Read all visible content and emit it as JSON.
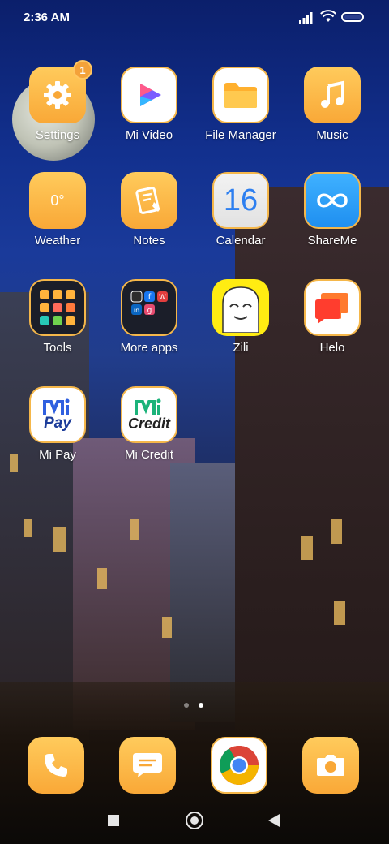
{
  "status_bar": {
    "time": "2:36 AM",
    "icons": [
      "signal-icon",
      "wifi-icon",
      "battery-icon"
    ]
  },
  "apps": [
    {
      "label": "Settings",
      "icon": "gear-icon",
      "badge": "1"
    },
    {
      "label": "Mi Video",
      "icon": "play-icon"
    },
    {
      "label": "File Manager",
      "icon": "folder-icon"
    },
    {
      "label": "Music",
      "icon": "music-note-icon"
    },
    {
      "label": "Weather",
      "icon": "weather-icon",
      "icon_text": "0°"
    },
    {
      "label": "Notes",
      "icon": "note-pencil-icon"
    },
    {
      "label": "Calendar",
      "icon": "calendar-icon",
      "icon_text": "16"
    },
    {
      "label": "ShareMe",
      "icon": "infinity-icon"
    },
    {
      "label": "Tools",
      "icon": "tools-folder-icon"
    },
    {
      "label": "More apps",
      "icon": "apps-folder-icon"
    },
    {
      "label": "Zili",
      "icon": "ghost-face-icon"
    },
    {
      "label": "Helo",
      "icon": "chat-bubbles-icon"
    },
    {
      "label": "Mi Pay",
      "icon": "mi-pay-logo",
      "logo_text": "Pay"
    },
    {
      "label": "Mi Credit",
      "icon": "mi-credit-logo",
      "logo_text": "Credit"
    }
  ],
  "page_indicator": {
    "pages": 2,
    "current": 2
  },
  "dock": [
    {
      "icon": "phone-icon"
    },
    {
      "icon": "message-icon"
    },
    {
      "icon": "chrome-icon"
    },
    {
      "icon": "camera-icon"
    }
  ],
  "navbar": [
    "recents-button",
    "home-button",
    "back-button"
  ],
  "colors": {
    "icon_gradient_top": "#ffcb5c",
    "icon_gradient_bottom": "#f9a837",
    "accent": "#f5b74a"
  }
}
